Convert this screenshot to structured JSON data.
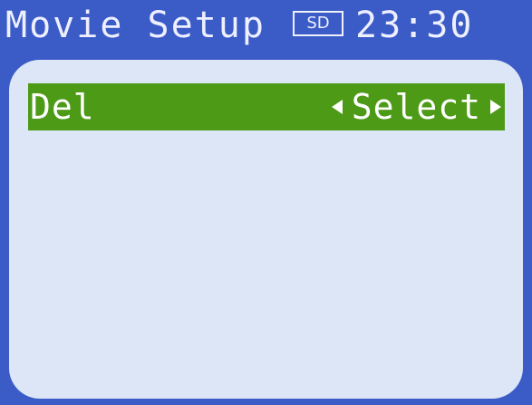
{
  "header": {
    "title": "Movie Setup",
    "media_badge": "SD",
    "time": "23:30"
  },
  "menu": {
    "items": [
      {
        "label": "Del",
        "value": "Select",
        "selected": true
      }
    ]
  },
  "colors": {
    "background": "#3b5bc7",
    "panel": "#dde6f6",
    "selected_row": "#4c9a16",
    "text": "#eef0ff"
  },
  "icons": {
    "left": "left-triangle-icon",
    "right": "right-triangle-icon"
  }
}
